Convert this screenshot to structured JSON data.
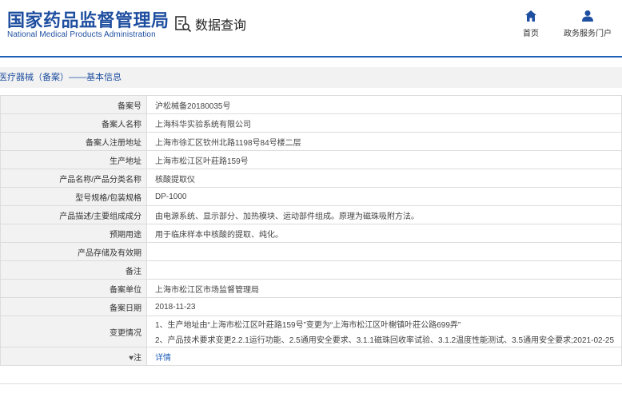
{
  "header": {
    "logo_cn": "国家药品监督管理局",
    "logo_en": "National Medical Products Administration",
    "query_label": "数据查询",
    "nav": [
      {
        "label": "首页",
        "icon": "home-icon"
      },
      {
        "label": "政务服务门户",
        "icon": "user-icon"
      }
    ]
  },
  "breadcrumb": "医疗器械（备案）——基本信息",
  "colors": {
    "brand": "#1f4fa0",
    "accent_line": "#1f5fb8",
    "label_bg": "#f2f2f2"
  },
  "rows": [
    {
      "label": "备案号",
      "value": "沪松械备20180035号"
    },
    {
      "label": "备案人名称",
      "value": "上海科华实验系统有限公司"
    },
    {
      "label": "备案人注册地址",
      "value": "上海市徐汇区钦州北路1198号84号楼二层"
    },
    {
      "label": "生产地址",
      "value": "上海市松江区叶莊路159号"
    },
    {
      "label": "产品名称/产品分类名称",
      "value": "核酸提取仪"
    },
    {
      "label": "型号规格/包装规格",
      "value": "DP-1000"
    },
    {
      "label": "产品描述/主要组成成分",
      "value": "由电源系统、显示部分、加热模块、运动部件组成。原理为磁珠吸附方法。"
    },
    {
      "label": "预期用途",
      "value": "用于临床样本中核酸的提取、纯化。"
    },
    {
      "label": "产品存储及有效期",
      "value": ""
    },
    {
      "label": "备注",
      "value": ""
    },
    {
      "label": "备案单位",
      "value": "上海市松江区市场监督管理局"
    },
    {
      "label": "备案日期",
      "value": "2018-11-23"
    },
    {
      "label": "变更情况",
      "line1": "1、生产地址由“上海市松江区叶莊路159号”变更为“上海市松江区叶榭镇叶莊公路699弄”",
      "line2": "2、产品技术要求变更2.2.1运行功能、2.5通用安全要求、3.1.1磁珠回收率试验、3.1.2温度性能测试、3.5通用安全要求;2021-02-25"
    },
    {
      "label": "注",
      "pin": "♥",
      "value": "详情"
    }
  ]
}
